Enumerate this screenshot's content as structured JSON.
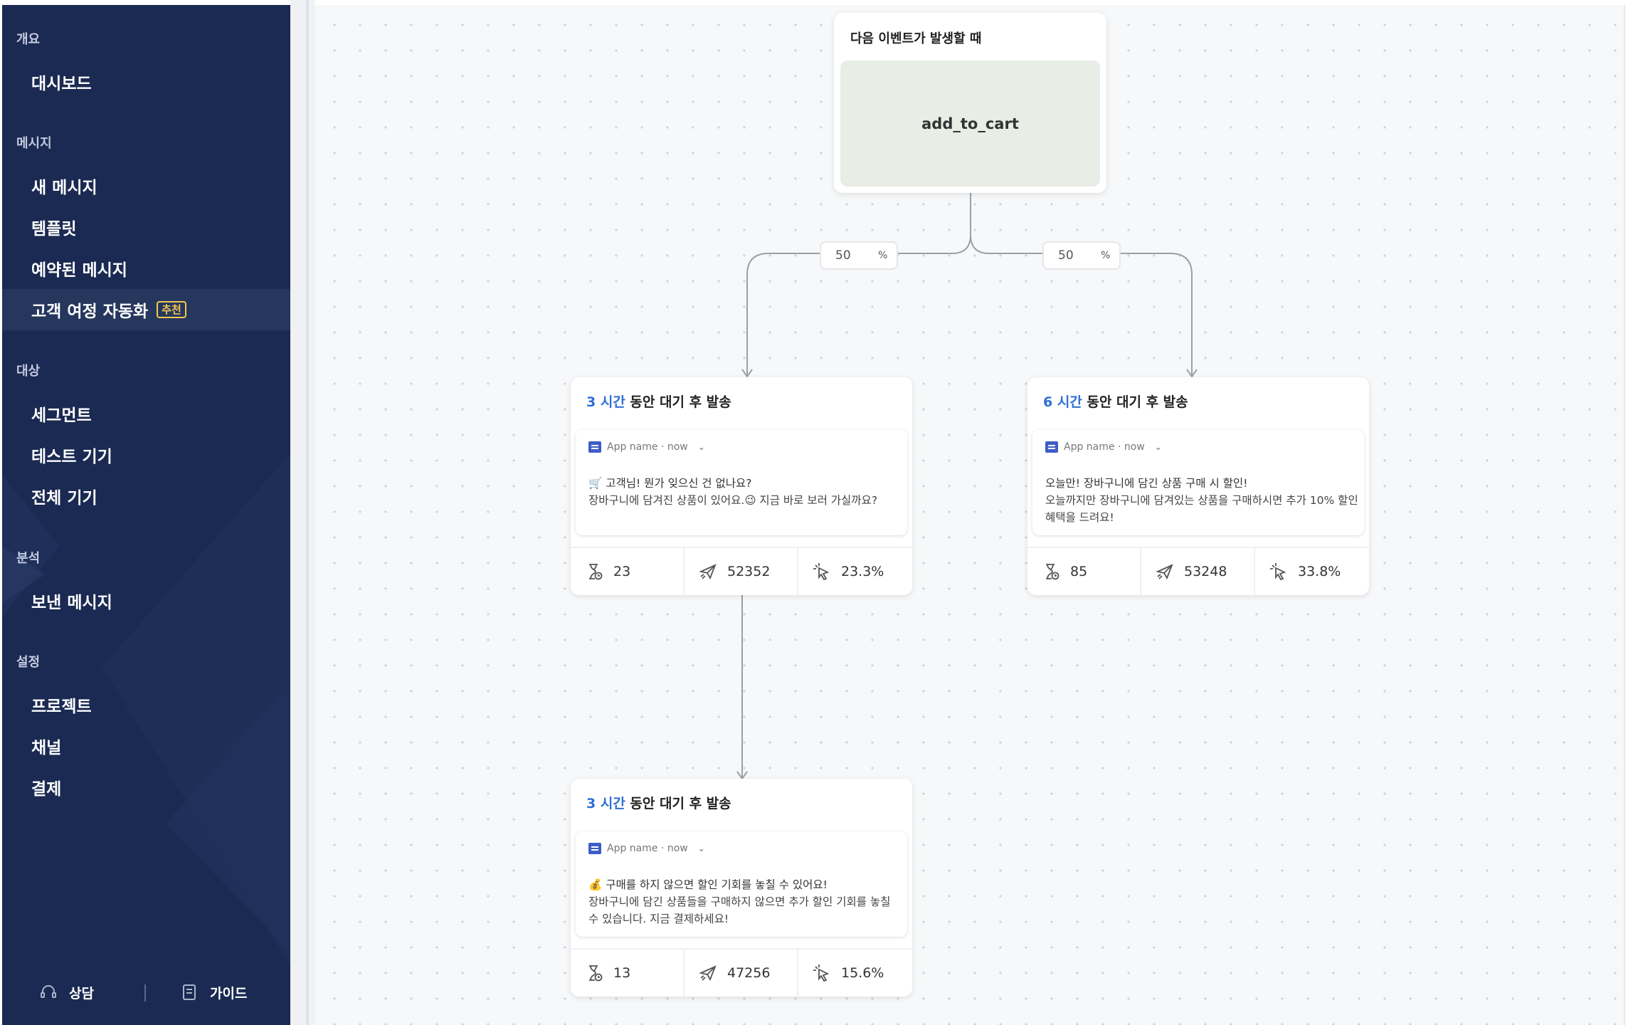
{
  "sidebar": {
    "sections": [
      {
        "label": "개요",
        "items": [
          {
            "label": "대시보드"
          }
        ]
      },
      {
        "label": "메시지",
        "items": [
          {
            "label": "새 메시지"
          },
          {
            "label": "템플릿"
          },
          {
            "label": "예약된 메시지"
          },
          {
            "label": "고객 여정 자동화",
            "badge": "추천",
            "active": true
          }
        ]
      },
      {
        "label": "대상",
        "items": [
          {
            "label": "세그먼트"
          },
          {
            "label": "테스트 기기"
          },
          {
            "label": "전체 기기"
          }
        ]
      },
      {
        "label": "분석",
        "items": [
          {
            "label": "보낸 메시지"
          }
        ]
      },
      {
        "label": "설정",
        "items": [
          {
            "label": "프로젝트"
          },
          {
            "label": "채널"
          },
          {
            "label": "결제"
          }
        ]
      }
    ],
    "footer": {
      "consult_label": "상담",
      "guide_label": "가이드"
    }
  },
  "flow": {
    "trigger": {
      "title": "다음 이벤트가 발생할 때",
      "event": "add_to_cart"
    },
    "splits": [
      {
        "value": "50",
        "unit": "%"
      },
      {
        "value": "50",
        "unit": "%"
      }
    ],
    "nodes": [
      {
        "wait_hours": "3 시간",
        "head_suffix": "동안 대기 후 발송",
        "app_meta": "App name · now",
        "title": "🛒 고객님! 뭔가 잊으신 건 없나요?",
        "body": "장바구니에 담겨진 상품이 있어요.😉 지금 바로 보러 가실까요?",
        "stats": {
          "waiting": "23",
          "sent": "52352",
          "click_rate": "23.3%"
        }
      },
      {
        "wait_hours": "6 시간",
        "head_suffix": "동안 대기 후 발송",
        "app_meta": "App name · now",
        "title": "오늘만! 장바구니에 담긴 상품 구매 시 할인!",
        "body": "오늘까지만 장바구니에 담겨있는 상품을 구매하시면 추가 10% 할인 혜택을 드려요!",
        "stats": {
          "waiting": "85",
          "sent": "53248",
          "click_rate": "33.8%"
        }
      },
      {
        "wait_hours": "3 시간",
        "head_suffix": "동안 대기 후 발송",
        "app_meta": "App name · now",
        "title": "💰 구매를 하지 않으면 할인 기회를 놓칠 수 있어요!",
        "body": "장바구니에 담긴 상품들을 구매하지 않으면 추가 할인 기회를 놓칠 수 있습니다. 지금 결제하세요!",
        "stats": {
          "waiting": "13",
          "sent": "47256",
          "click_rate": "15.6%"
        }
      }
    ]
  },
  "colors": {
    "sidebar_bg": "#1b2a52",
    "active_item_bg": "#26375e",
    "badge": "#f2c94c",
    "accent_blue": "#2f6fd6",
    "canvas_bg": "#f7f8f9"
  },
  "icons": [
    "headset-icon",
    "guide-book-icon",
    "hourglass-icon",
    "send-plane-icon",
    "cursor-click-icon",
    "app-icon",
    "chevron-down-icon"
  ]
}
